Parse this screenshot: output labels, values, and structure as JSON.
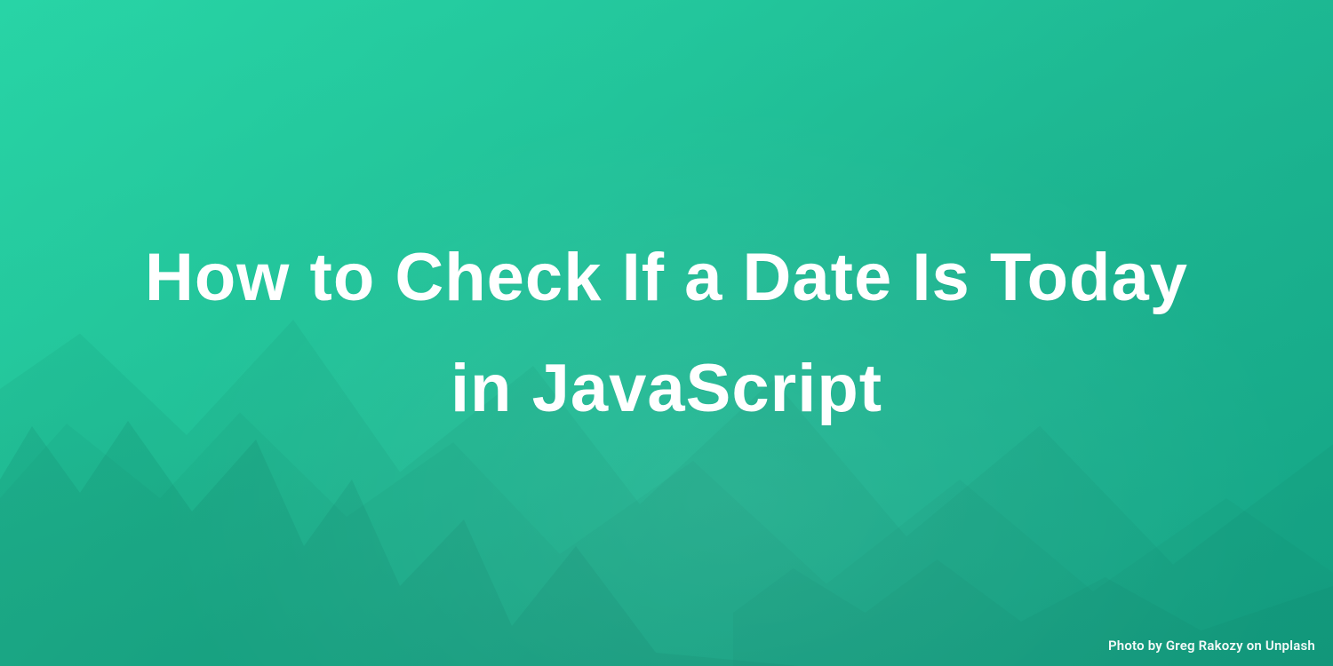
{
  "title": "How to Check If a Date Is Today in JavaScript",
  "credit": "Photo by Greg Rakozy on Unplash"
}
